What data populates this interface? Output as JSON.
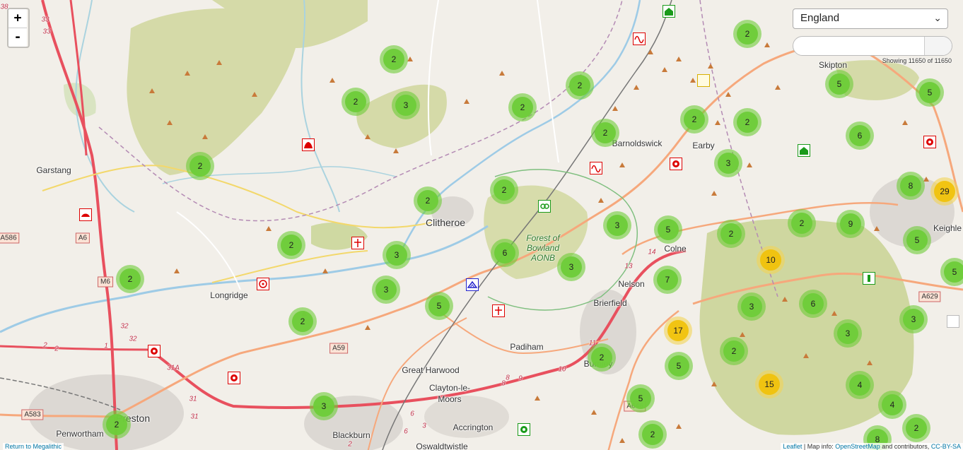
{
  "zoom": {
    "in_label": "+",
    "out_label": "-"
  },
  "region_select": {
    "selected": "England"
  },
  "showing_text": "Showing 11650 of 11650",
  "return_link": "Return to Megalithic",
  "attribution": {
    "leaflet": "Leaflet",
    "sep1": " | Map info: ",
    "osm": "OpenStreetMap",
    "sep2": " and contributors, ",
    "license": "CC-BY-SA"
  },
  "colors": {
    "cluster_small": "#6ecc39",
    "cluster_medium": "#f0c20c",
    "motorway": "#e8505e",
    "primary_road": "#f6a87c",
    "secondary_road": "#f3d86b",
    "river": "#9ecbe6",
    "national_park": "#c8d49a",
    "marker_border": "#dd0000",
    "peak": "#c87a3a"
  },
  "places": [
    {
      "id": "garstang",
      "label": "Garstang"
    },
    {
      "id": "clitheroe",
      "label": "Clitheroe"
    },
    {
      "id": "longridge",
      "label": "Longridge"
    },
    {
      "id": "barnoldswick",
      "label": "Barnoldswick"
    },
    {
      "id": "earby",
      "label": "Earby"
    },
    {
      "id": "skipton",
      "label": "Skipton"
    },
    {
      "id": "colne",
      "label": "Colne"
    },
    {
      "id": "nelson",
      "label": "Nelson"
    },
    {
      "id": "brierfield",
      "label": "Brierfield"
    },
    {
      "id": "padiham",
      "label": "Padiham"
    },
    {
      "id": "great-harwood",
      "label": "Great Harwood"
    },
    {
      "id": "clayton-le",
      "label": "Clayton-le-"
    },
    {
      "id": "moors",
      "label": "Moors"
    },
    {
      "id": "accrington",
      "label": "Accrington"
    },
    {
      "id": "blackburn",
      "label": "Blackburn"
    },
    {
      "id": "penwortham",
      "label": "Penwortham"
    },
    {
      "id": "preston",
      "label": "Preston"
    },
    {
      "id": "keighley",
      "label": "Keighle"
    },
    {
      "id": "burnley",
      "label": "Burnley"
    },
    {
      "id": "oswaldtwistle",
      "label": "Oswaldtwistle"
    }
  ],
  "aonb": {
    "line1": "Forest of",
    "line2": "Bowland",
    "line3": "AONB"
  },
  "road_labels": [
    "A586",
    "A6",
    "M6",
    "A59",
    "A583",
    "A629",
    "A646"
  ],
  "junctions": [
    "33",
    "33",
    "32",
    "32",
    "31A",
    "31",
    "31",
    "14",
    "13",
    "11",
    "10",
    "9",
    "8",
    "8",
    "6",
    "6",
    "2",
    "2",
    "1",
    "2",
    "3",
    "38"
  ],
  "clusters": [
    "2",
    "2",
    "3",
    "2",
    "2",
    "2",
    "2",
    "2",
    "2",
    "2",
    "2",
    "2",
    "3",
    "2",
    "3",
    "2",
    "6",
    "3",
    "5",
    "2",
    "5",
    "2",
    "9",
    "29",
    "5",
    "8",
    "5",
    "6",
    "5",
    "10",
    "7",
    "3",
    "6",
    "2",
    "3",
    "3",
    "2",
    "17",
    "3",
    "5",
    "2",
    "5",
    "5",
    "15",
    "4",
    "4",
    "3",
    "2",
    "2",
    "3",
    "8",
    "2"
  ]
}
